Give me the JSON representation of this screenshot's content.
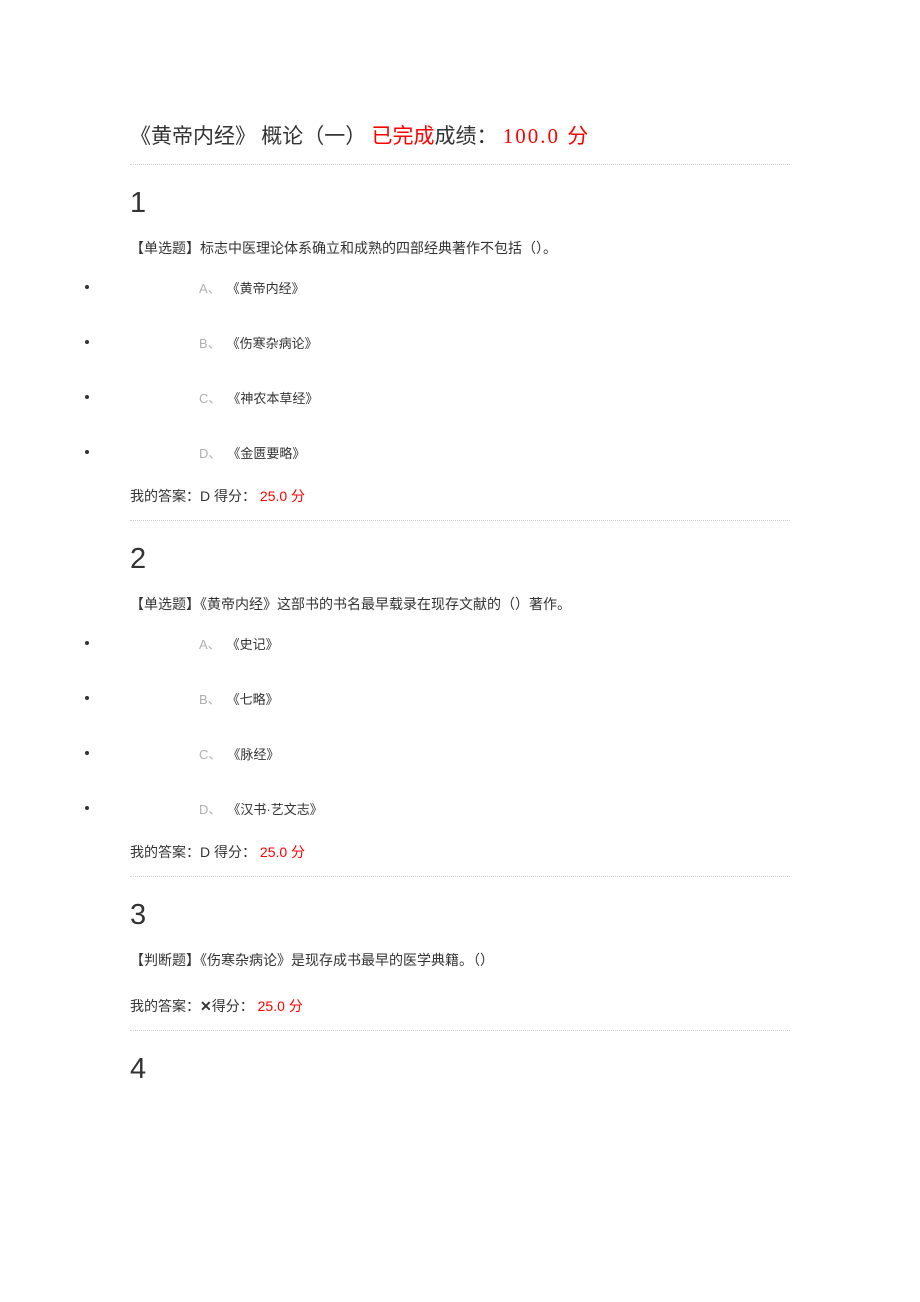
{
  "header": {
    "title": "《黄帝内经》 概论（一）",
    "status": "已完成",
    "score_label": "成绩：",
    "score_value": "100.0",
    "score_unit": "分"
  },
  "questions": [
    {
      "number": "1",
      "type_label": "【单选题】",
      "stem": "标志中医理论体系确立和成熟的四部经典著作不包括（）。",
      "options": [
        {
          "letter": "A、",
          "text": "《黄帝内经》"
        },
        {
          "letter": "B、",
          "text": "《伤寒杂病论》"
        },
        {
          "letter": "C、",
          "text": "《神农本草经》"
        },
        {
          "letter": "D、",
          "text": "《金匮要略》"
        }
      ],
      "answer": {
        "label": "我的答案：",
        "value": "D",
        "score_label": "得分：",
        "score_value": "25.0",
        "score_unit": "分"
      }
    },
    {
      "number": "2",
      "type_label": "【单选题】",
      "stem": "《黄帝内经》这部书的书名最早载录在现存文献的（）著作。",
      "options": [
        {
          "letter": "A、",
          "text": "《史记》"
        },
        {
          "letter": "B、",
          "text": "《七略》"
        },
        {
          "letter": "C、",
          "text": "《脉经》"
        },
        {
          "letter": "D、",
          "text": "《汉书·艺文志》"
        }
      ],
      "answer": {
        "label": "我的答案：",
        "value": "D",
        "score_label": "得分：",
        "score_value": "25.0",
        "score_unit": "分"
      }
    },
    {
      "number": "3",
      "type_label": "【判断题】",
      "stem": "《伤寒杂病论》是现存成书最早的医学典籍。（）",
      "answer": {
        "label": "我的答案：",
        "value": "✕",
        "score_label": "得分：",
        "score_value": "25.0",
        "score_unit": "分"
      }
    }
  ],
  "question4_number": "4"
}
